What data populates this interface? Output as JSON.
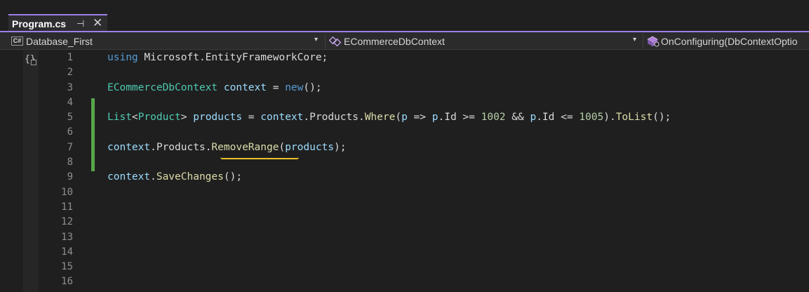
{
  "tab": {
    "title": "Program.cs",
    "pin_glyph": "⊣",
    "close_glyph": "✕"
  },
  "navbar": {
    "project_icon": "C#",
    "project": "Database_First",
    "class_icon": "class-icon",
    "class": "ECommerceDbContext",
    "method_icon": "method-icon",
    "method": "OnConfiguring(DbContextOptio",
    "dropdown_glyph": "▾"
  },
  "editor": {
    "line_numbers": [
      "1",
      "2",
      "3",
      "4",
      "5",
      "6",
      "7",
      "8",
      "9",
      "10",
      "11",
      "12",
      "13",
      "14",
      "15",
      "16"
    ],
    "lines": {
      "l1": {
        "kw": "using",
        "rest": " Microsoft.EntityFrameworkCore;"
      },
      "l3": {
        "type": "ECommerceDbContext",
        "var": "context",
        "eq": " = ",
        "kw": "new",
        "end": "();"
      },
      "l5": {
        "type1": "List",
        "lt": "<",
        "type2": "Product",
        "gt": "> ",
        "var": "products",
        "eq": " = ",
        "ctx": "context",
        "dot1": ".",
        "prop": "Products",
        "dot2": ".",
        "fn1": "Where",
        "p1": "(",
        "param": "p",
        "arrow": " => ",
        "pref1": "p",
        "id1": ".Id",
        "op1": " >= ",
        "n1": "1002",
        "and": " && ",
        "pref2": "p",
        "id2": ".Id",
        "op2": " <= ",
        "n2": "1005",
        "close": ").",
        "fn2": "ToList",
        "end": "();"
      },
      "l7": {
        "ctx": "context",
        "dot1": ".",
        "prop": "Products",
        "dot2": ".",
        "fn": "RemoveRange",
        "p1": "(",
        "arg": "products",
        "end": ");"
      },
      "l9": {
        "ctx": "context",
        "dot": ".",
        "fn": "SaveChanges",
        "end": "();"
      }
    },
    "colors": {
      "keyword": "#569cd6",
      "type": "#4ec9b0",
      "variable": "#9cdcfe",
      "method": "#dcdcaa",
      "number": "#b5cea8",
      "change_bar": "#57a64a",
      "squiggle": "#e8c22c",
      "accent": "#9d80e8"
    }
  }
}
